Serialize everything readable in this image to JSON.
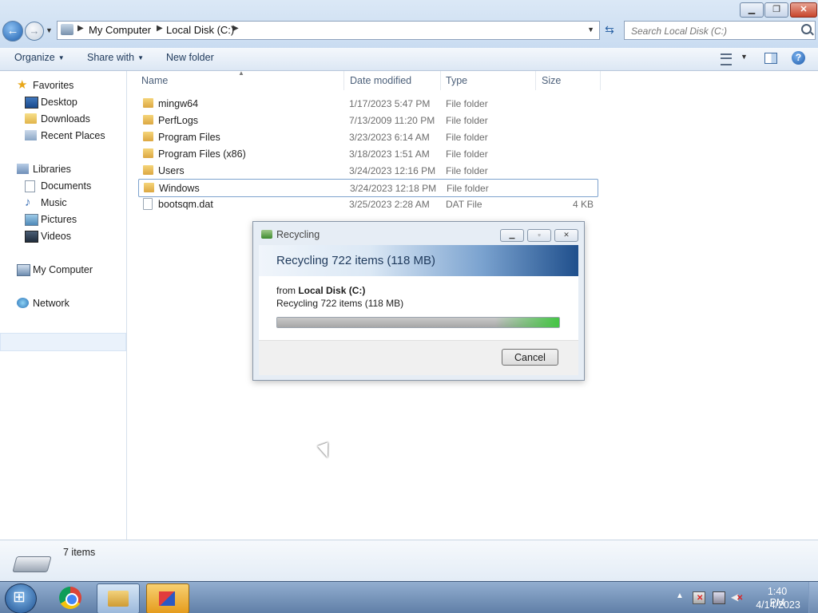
{
  "window": {
    "min_glyph": "▁",
    "max_glyph": "❐",
    "close_glyph": "✕"
  },
  "nav": {
    "back_glyph": "←",
    "forward_glyph": "→"
  },
  "address": {
    "crumbs": [
      "My Computer",
      "Local Disk (C:)"
    ]
  },
  "search": {
    "placeholder": "Search Local Disk (C:)"
  },
  "toolbar": {
    "organize": "Organize",
    "share_with": "Share with",
    "new_folder": "New folder",
    "help_glyph": "?"
  },
  "sidebar": {
    "favorites": {
      "label": "Favorites",
      "items": [
        "Desktop",
        "Downloads",
        "Recent Places"
      ]
    },
    "libraries": {
      "label": "Libraries",
      "items": [
        "Documents",
        "Music",
        "Pictures",
        "Videos"
      ]
    },
    "computer": "My Computer",
    "network": "Network"
  },
  "columns": {
    "name": "Name",
    "date_modified": "Date modified",
    "type": "Type",
    "size": "Size"
  },
  "files": [
    {
      "name": "mingw64",
      "date": "1/17/2023 5:47 PM",
      "type": "File folder",
      "size": ""
    },
    {
      "name": "PerfLogs",
      "date": "7/13/2009 11:20 PM",
      "type": "File folder",
      "size": ""
    },
    {
      "name": "Program Files",
      "date": "3/23/2023 6:14 AM",
      "type": "File folder",
      "size": ""
    },
    {
      "name": "Program Files (x86)",
      "date": "3/18/2023 1:51 AM",
      "type": "File folder",
      "size": ""
    },
    {
      "name": "Users",
      "date": "3/24/2023 12:16 PM",
      "type": "File folder",
      "size": ""
    },
    {
      "name": "Windows",
      "date": "3/24/2023 12:18 PM",
      "type": "File folder",
      "size": ""
    },
    {
      "name": "bootsqm.dat",
      "date": "3/25/2023 2:28 AM",
      "type": "DAT File",
      "size": "4 KB"
    }
  ],
  "dialog": {
    "title": "Recycling",
    "header": "Recycling 722 items (118 MB)",
    "from_label": "from ",
    "from_value": "Local Disk (C:)",
    "status": "Recycling 722 items (118 MB)",
    "progress": 1.0,
    "cancel": "Cancel",
    "min_glyph": "▁",
    "max_glyph": "▫",
    "close_glyph": "✕"
  },
  "details": {
    "count": "7 items"
  },
  "taskbar": {
    "time": "1:40 PM",
    "date": "4/14/2023"
  },
  "colors": {
    "accent": "#1e395b",
    "selection_border": "#7da2ce",
    "progress_green": "#44c544"
  },
  "icons": [
    "back-arrow-icon",
    "forward-arrow-icon",
    "computer-icon",
    "refresh-icon",
    "search-icon",
    "views-icon",
    "preview-pane-icon",
    "help-icon",
    "star-icon",
    "folder-icon",
    "file-icon",
    "drive-icon",
    "recycle-icon",
    "windows-logo-icon",
    "chrome-icon",
    "explorer-icon",
    "network-icon",
    "volume-muted-icon",
    "action-center-icon"
  ]
}
